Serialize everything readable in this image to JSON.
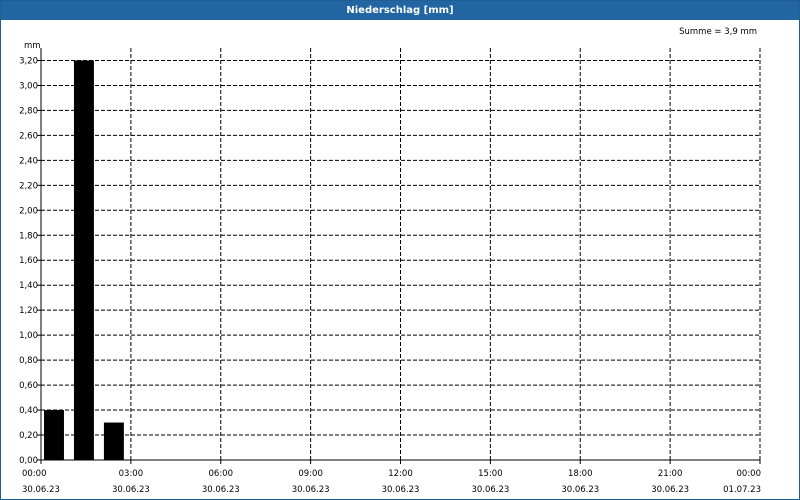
{
  "window": {
    "title": "Niederschlag [mm]"
  },
  "summary": "Summe = 3,9 mm",
  "chart_data": {
    "type": "bar",
    "title": "Niederschlag [mm]",
    "ylabel": "mm",
    "ylim": [
      0,
      3.3
    ],
    "yticks": [
      "0,00",
      "0,20",
      "0,40",
      "0,60",
      "0,80",
      "1,00",
      "1,20",
      "1,40",
      "1,60",
      "1,80",
      "2,00",
      "2,20",
      "2,40",
      "2,60",
      "2,80",
      "3,00",
      "3,20"
    ],
    "xticks": [
      {
        "time": "00:00",
        "date": "30.06.23"
      },
      {
        "time": "03:00",
        "date": "30.06.23"
      },
      {
        "time": "06:00",
        "date": "30.06.23"
      },
      {
        "time": "09:00",
        "date": "30.06.23"
      },
      {
        "time": "12:00",
        "date": "30.06.23"
      },
      {
        "time": "15:00",
        "date": "30.06.23"
      },
      {
        "time": "18:00",
        "date": "30.06.23"
      },
      {
        "time": "21:00",
        "date": "30.06.23"
      },
      {
        "time": "00:00",
        "date": "01.07.23"
      }
    ],
    "series": [
      {
        "values": [
          0.4,
          3.2,
          0.3
        ],
        "hours": [
          0,
          1,
          2
        ],
        "color": "#000000"
      }
    ],
    "grid": true
  }
}
